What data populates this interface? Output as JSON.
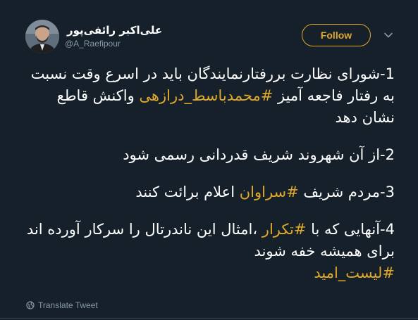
{
  "user": {
    "display_name": "علی‌اکبر رائفی‌پور",
    "handle": "@A_Raefipour"
  },
  "actions": {
    "follow_label": "Follow",
    "translate_label": "Translate Tweet"
  },
  "icons": {
    "caret": "chevron-down-icon",
    "translate": "globe-icon"
  },
  "colors": {
    "background": "#15202b",
    "accent": "#e0a92a",
    "secondary_text": "#8899a6"
  },
  "tweet": {
    "p1_a": "1-شورای نظارت بررفتارنمایندگان باید در اسرع وقت نسبت به رفتار فاجعه آمیز ",
    "p1_tag": "#محمدباسط_درازهی",
    "p1_b": " واکنش قاطع نشان دهد",
    "p2": "2-از آن شهروند شریف قدردانی رسمی شود",
    "p3_a": "3-مردم شریف ",
    "p3_tag": "#سراوان",
    "p3_b": " اعلام برائت کنند",
    "p4_a": "4-آنهایی که با ",
    "p4_tag": "#تکرار",
    "p4_b": " ،امثال این ناندرتال را سرکار آورده اند برای همیشه خفه شوند",
    "p5_tag": "#لیست_امید"
  }
}
